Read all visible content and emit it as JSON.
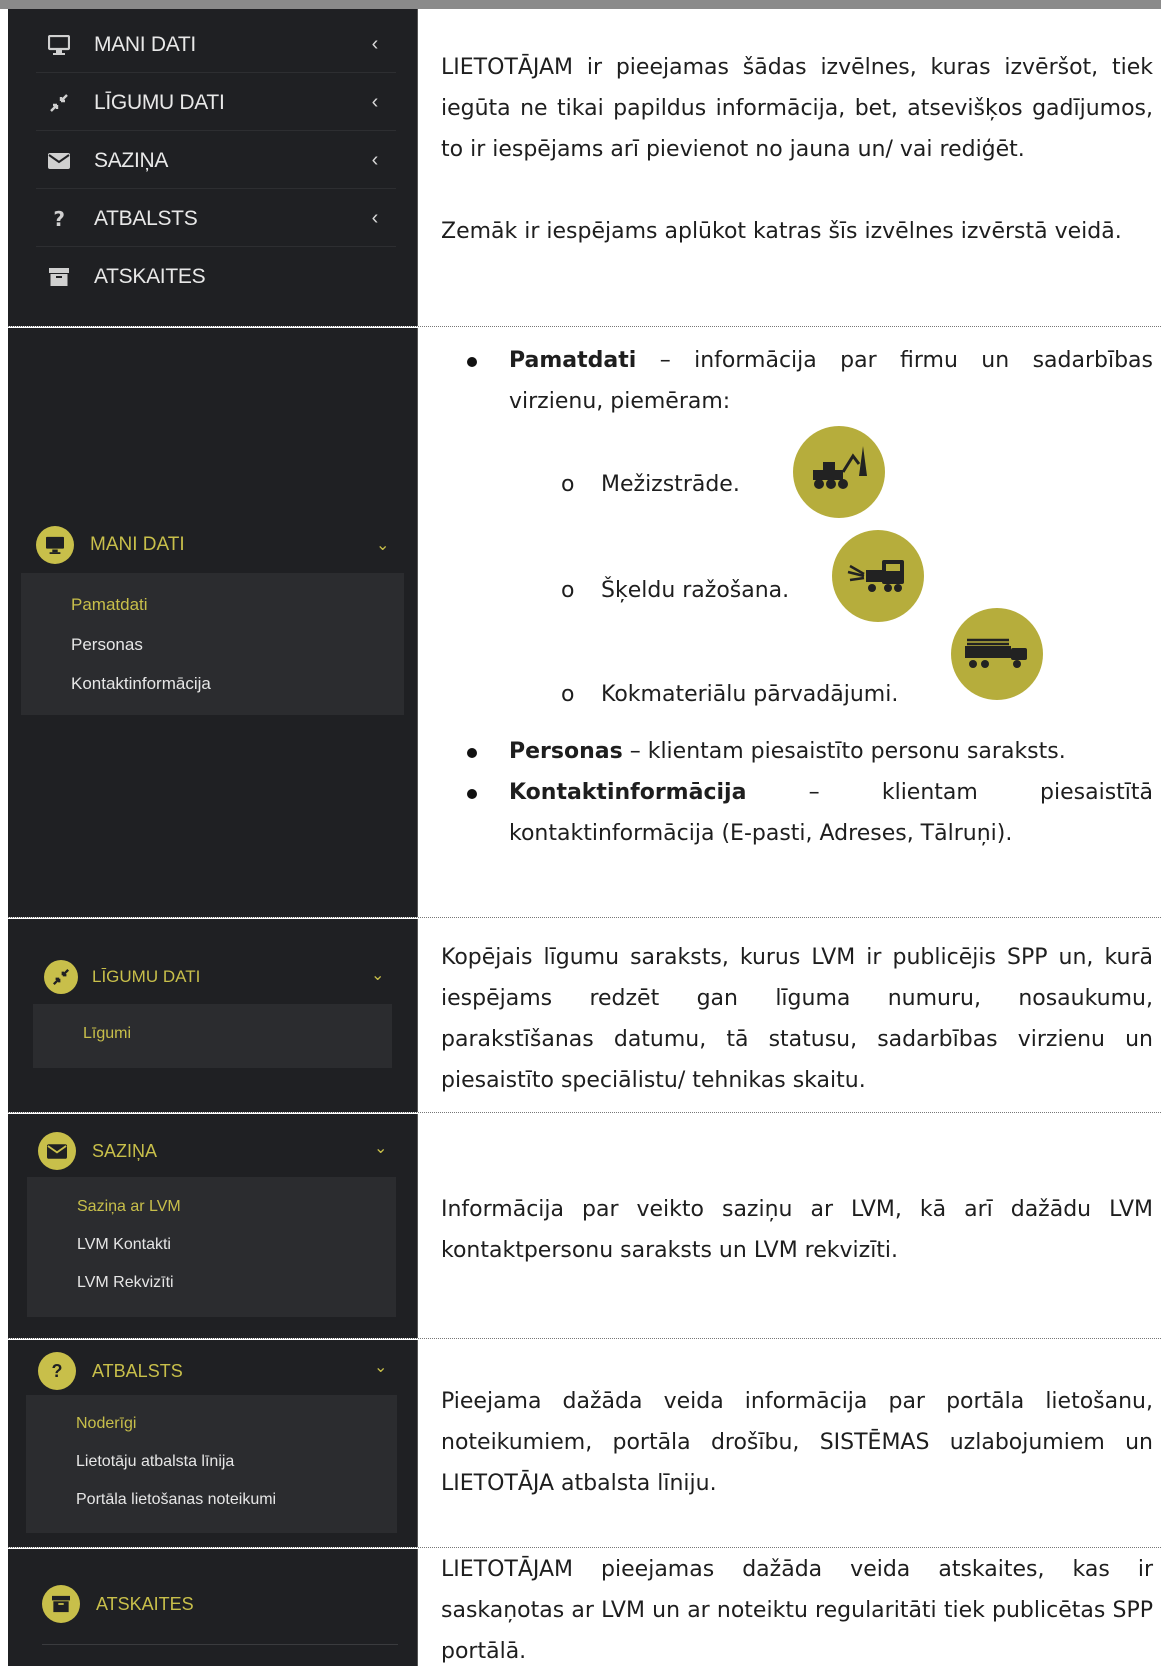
{
  "menu": [
    {
      "label": "MANI DATI",
      "icon": "monitor-icon"
    },
    {
      "label": "LĪGUMU DATI",
      "icon": "compress-icon"
    },
    {
      "label": "SAZIŅA",
      "icon": "envelope-icon"
    },
    {
      "label": "ATBALSTS",
      "icon": "question-icon"
    },
    {
      "label": "ATSKAITES",
      "icon": "archive-icon"
    }
  ],
  "intro": {
    "p1": "LIETOTĀJAM ir pieejamas šādas izvēlnes, kuras izvēršot, tiek iegūta ne tikai papildus informācija, bet, atsevišķos gadījumos, to ir iespējams arī pievienot no jauna un/ vai rediģēt.",
    "p2": "Zemāk ir iespējams aplūkot katras šīs izvēlnes izvērstā veidā."
  },
  "mani_dati": {
    "title": "MANI DATI",
    "items": [
      "Pamatdati",
      "Personas",
      "Kontaktinformācija"
    ],
    "b1_bold": "Pamatdati",
    "b1_text": " – informācija par firmu un sadarbības virzienu, piemēram:",
    "sub1": "Mežizstrāde.",
    "sub2": "Šķeldu ražošana.",
    "sub3": "Kokmateriālu pārvadājumi.",
    "b2_bold": "Personas",
    "b2_text": " – klientam piesaistīto personu saraksts.",
    "b3_bold": "Kontaktinformācija",
    "b3_text": " – klientam piesaistītā kontaktinformācija (E-pasti, Adreses, Tālruņi)."
  },
  "ligumu_dati": {
    "title": "LĪGUMU DATI",
    "items": [
      "Līgumi"
    ],
    "text": "Kopējais līgumu saraksts, kurus LVM ir publicējis SPP un, kurā iespējams redzēt gan līguma numuru, nosaukumu, parakstīšanas datumu, tā statusu, sadarbības virzienu un piesaistīto speciālistu/ tehnikas skaitu."
  },
  "sazina": {
    "title": "SAZIŅA",
    "items": [
      "Saziņa ar LVM",
      "LVM Kontakti",
      "LVM Rekvizīti"
    ],
    "text": "Informācija par veikto saziņu ar LVM, kā arī dažādu LVM kontaktpersonu saraksts un LVM rekvizīti."
  },
  "atbalsts": {
    "title": "ATBALSTS",
    "items": [
      "Noderīgi",
      "Lietotāju atbalsta līnija",
      "Portāla lietošanas noteikumi"
    ],
    "text": "Pieejama dažāda veida informācija par portāla lietošanu, noteikumiem, portāla drošību, SISTĒMAS uzlabojumiem un LIETOTĀJA atbalsta līniju."
  },
  "atskaites": {
    "title": "ATSKAITES",
    "text": "LIETOTĀJAM pieejamas dažāda veida atskaites, kas ir saskaņotas ar LVM un ar noteiktu regularitāti tiek publicētas SPP portālā."
  },
  "colors": {
    "accent": "#c8bf4a",
    "sidebar": "#1f2023",
    "badge": "#b6ad3c"
  }
}
